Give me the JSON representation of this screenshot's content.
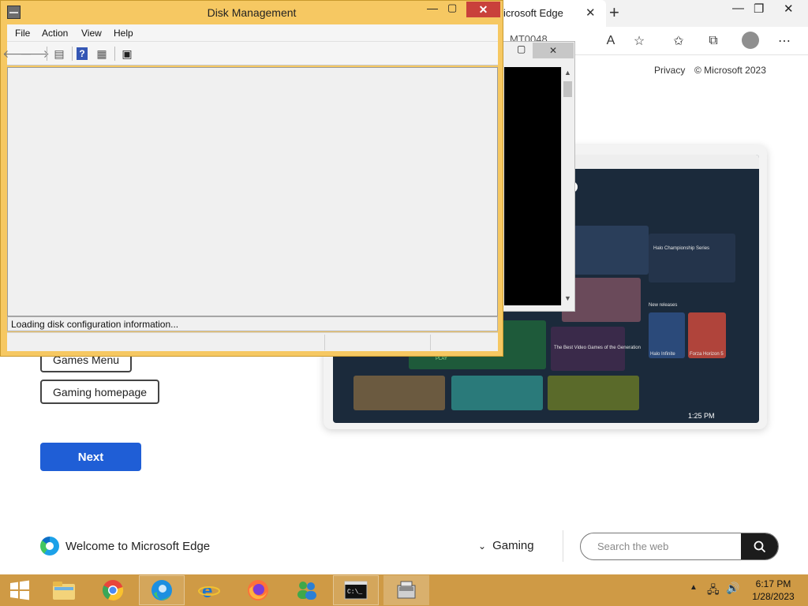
{
  "edge": {
    "tab_title": "icrosoft Edge",
    "address_fragment": "MT0048",
    "privacy_link": "Privacy",
    "copyright": "© Microsoft 2023",
    "buttons": {
      "games_menu": "Games Menu",
      "gaming_homepage": "Gaming homepage",
      "next": "Next"
    },
    "footer": {
      "welcome": "Welcome to Microsoft Edge",
      "gaming_dropdown": "Gaming",
      "search_placeholder": "Search the web"
    },
    "showcase": {
      "card_halo": "Halo Championship Series",
      "card_best_games": "The Best Video Games of the Generation",
      "new_releases": "New releases",
      "game_halo": "Halo Infinite",
      "game_forza": "Forza Horizon 5",
      "time": "1:25 PM",
      "play": "PLAY"
    }
  },
  "disk_management": {
    "title": "Disk Management",
    "menu": [
      "File",
      "Action",
      "View",
      "Help"
    ],
    "status_message": "Loading disk configuration information..."
  },
  "taskbar": {
    "time": "6:17 PM",
    "date": "1/28/2023"
  },
  "colors": {
    "taskbar": "#cf9a45",
    "window_frame": "#f6c862",
    "next_button": "#1f5ed6",
    "close_button": "#c9413b"
  }
}
